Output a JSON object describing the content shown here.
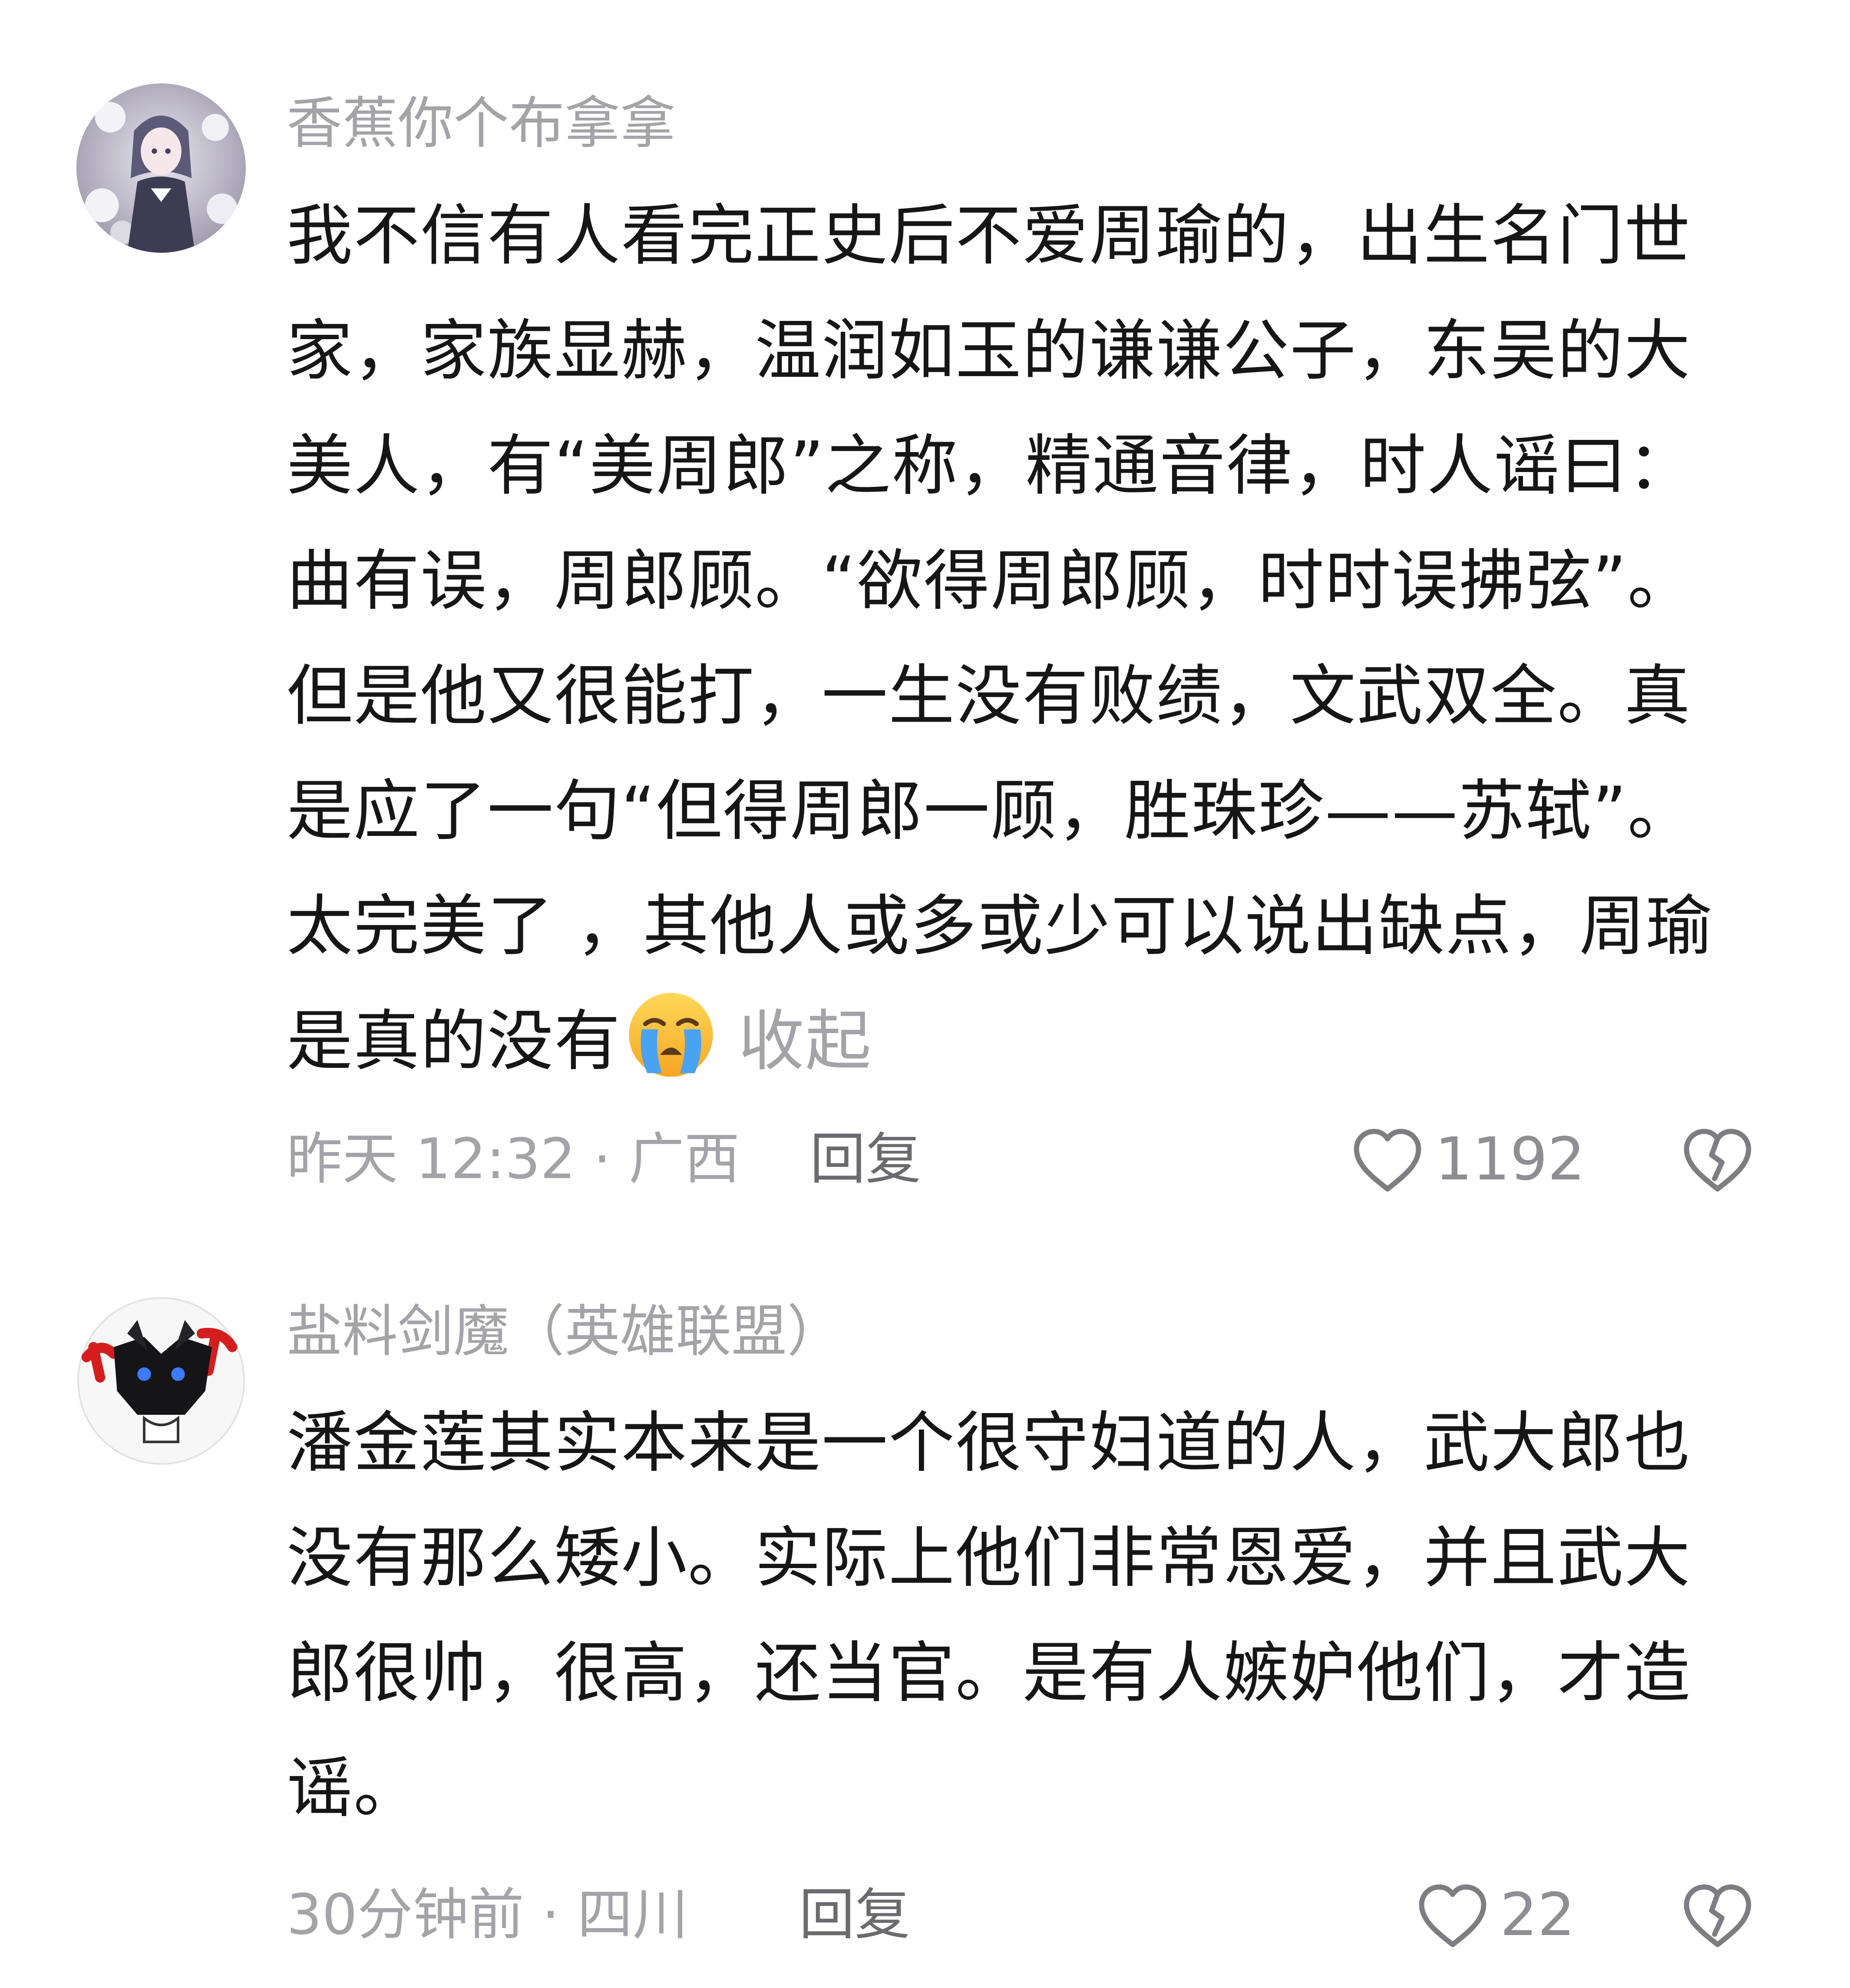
{
  "comments": [
    {
      "username": "香蕉你个布拿拿",
      "avatar_icon": "anime-girl-avatar-icon",
      "text_lines": [
        "我不信有人看完正史后不爱周瑜的，出生名门世",
        "家，家族显赫，温润如玉的谦谦公子，东吴的大",
        "美人，有“美周郎”之称，精通音律，时人谣曰：",
        "曲有误，周郎顾。“欲得周郎顾，时时误拂弦”。",
        "但是他又很能打，一生没有败绩，文武双全。真",
        "是应了一句“但得周郎一顾，胜珠珍——苏轼”。",
        "太完美了 ，其他人或多或少可以说出缺点，周瑜",
        "是真的没有"
      ],
      "emoji": "loudly-crying-face-icon",
      "collapse_label": "收起",
      "time_location": "昨天 12:32 · 广西",
      "reply_label": "回复",
      "like_count": "1192"
    },
    {
      "username": "盐料剑魔（英雄联盟）",
      "avatar_icon": "dark-character-avatar-icon",
      "text_lines": [
        "潘金莲其实本来是一个很守妇道的人，武大郎也",
        "没有那么矮小。实际上他们非常恩爱，并且武大",
        "郎很帅，很高，还当官。是有人嫉妒他们，才造",
        "谣。"
      ],
      "time_location": "30分钟前 · 四川",
      "reply_label": "回复",
      "like_count": "22"
    }
  ],
  "colors": {
    "meta_gray": "#a3a3a8",
    "text": "#161616",
    "icon_gray": "#7d7d82"
  }
}
